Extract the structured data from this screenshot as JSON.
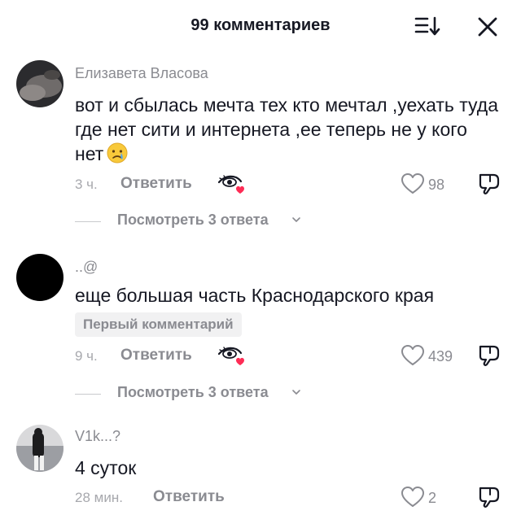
{
  "header": {
    "title": "99 комментариев",
    "sort_icon": "sort-icon",
    "close_icon": "close-icon"
  },
  "comments": [
    {
      "username": "Елизавета Власова",
      "text": "вот и сбылась мечта тех кто мечтал ,уехать туда где нет сити и интернета ,ее теперь не у кого нет",
      "emoji": "crying-face-emoji",
      "time": "3 ч.",
      "reply_label": "Ответить",
      "likes": "98",
      "view_replies": "Посмотреть 3 ответа"
    },
    {
      "username": "..@",
      "text": "еще большая часть Краснодарского края",
      "badge": "Первый комментарий",
      "time": "9 ч.",
      "reply_label": "Ответить",
      "likes": "439",
      "view_replies": "Посмотреть 3 ответа"
    },
    {
      "username": "V1k...?",
      "text": "4 суток",
      "time": "28 мин.",
      "reply_label": "Ответить",
      "likes": "2"
    }
  ],
  "colors": {
    "text_primary": "#161823",
    "text_secondary": "#8a8b91",
    "sticker_heart": "#fe2c55"
  }
}
